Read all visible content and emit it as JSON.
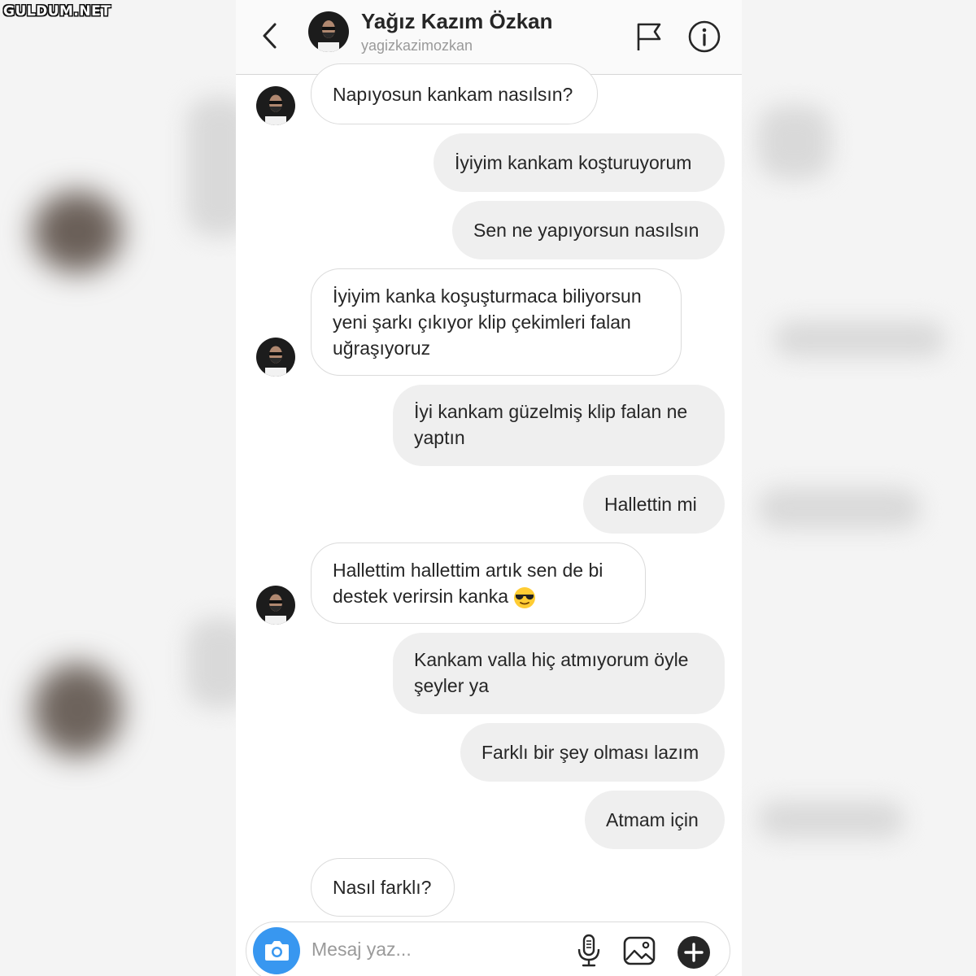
{
  "watermark": "GULDUM.NET",
  "header": {
    "name": "Yağız Kazım Özkan",
    "username": "yagizkazimozkan"
  },
  "messages": [
    {
      "side": "in",
      "text": "Napıyosun kankam nasılsın?"
    },
    {
      "side": "out",
      "text": "İyiyim kankam koşturuyorum"
    },
    {
      "side": "out",
      "text": "Sen ne yapıyorsun nasılsın"
    },
    {
      "side": "in",
      "text": "İyiyim kanka koşuşturmaca biliyorsun yeni şarkı çıkıyor klip çekimleri falan uğraşıyoruz"
    },
    {
      "side": "out",
      "text": "İyi kankam güzelmiş klip falan ne yaptın"
    },
    {
      "side": "out",
      "text": "Hallettin mi"
    },
    {
      "side": "in",
      "text": "Hallettim hallettim artık sen de bi destek verirsin kanka",
      "emoji": "sunglasses-emoji"
    },
    {
      "side": "out",
      "text": "Kankam valla hiç atmıyorum öyle şeyler ya"
    },
    {
      "side": "out",
      "text": "Farklı bir şey olması lazım"
    },
    {
      "side": "out",
      "text": "Atmam için"
    },
    {
      "side": "in",
      "text": "Nasıl farklı?"
    }
  ],
  "composer": {
    "placeholder": "Mesaj yaz..."
  },
  "colors": {
    "accent": "#3897f0",
    "incoming_border": "#dbdbdb",
    "outgoing_bg": "#efefef"
  }
}
